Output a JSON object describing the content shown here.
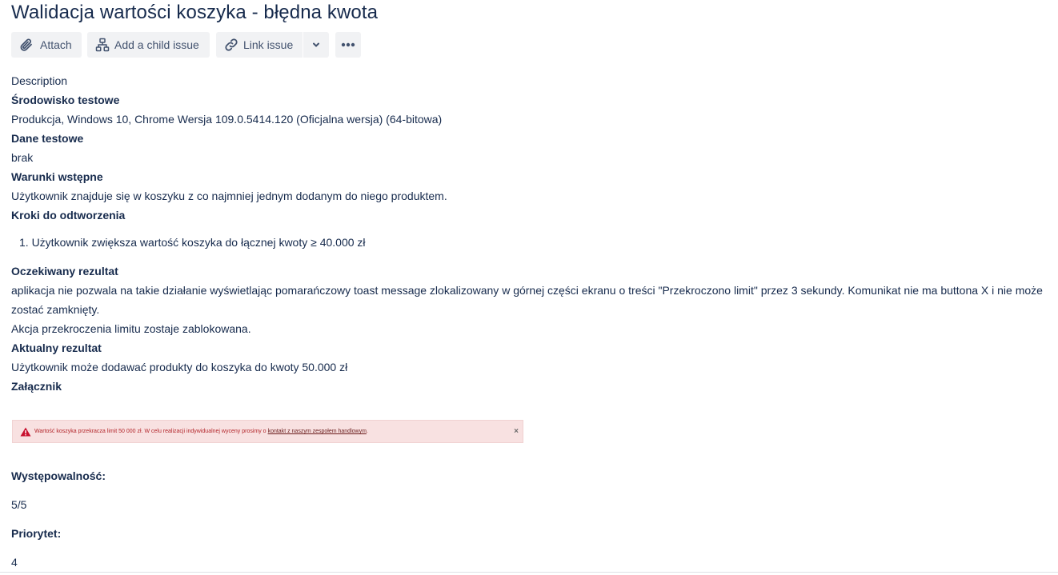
{
  "issue": {
    "title": "Walidacja wartości koszyka - błędna kwota"
  },
  "toolbar": {
    "attach_label": "Attach",
    "child_label": "Add a child issue",
    "link_label": "Link issue",
    "icons": [
      "attach-icon",
      "child-issue-icon",
      "link-icon",
      "chevron-down-icon",
      "more-icon"
    ]
  },
  "description": {
    "label": "Description",
    "env_heading": "Środowisko testowe",
    "env_text": "Produkcja, Windows 10, Chrome Wersja 109.0.5414.120 (Oficjalna wersja) (64-bitowa)",
    "data_heading": "Dane testowe",
    "data_text": "brak",
    "pre_heading": "Warunki wstępne",
    "pre_text": "Użytkownik znajduje się w koszyku z co najmniej jednym dodanym do niego produktem.",
    "steps_heading": "Kroki do odtworzenia",
    "steps": [
      "1. Użytkownik zwiększa wartość koszyka do łącznej kwoty ≥ 40.000 zł"
    ],
    "expected_heading": "Oczekiwany rezultat",
    "expected_text": "aplikacja nie pozwala na takie działanie wyświetlając pomarańczowy toast message zlokalizowany w górnej części ekranu o treści \"Przekroczono limit\" przez 3 sekundy. Komunikat nie ma buttona X i nie może zostać zamknięty.",
    "expected_text2": "Akcja przekroczenia limitu zostaje zablokowana.",
    "actual_heading": "Aktualny rezultat",
    "actual_text": "Użytkownik może dodawać produkty do koszyka do kwoty 50.000 zł",
    "attachment_heading": "Załącznik"
  },
  "attachment": {
    "message": "Wartość koszyka przekracza limit 50 000 zł. W celu realizacji indywidualnej wyceny prosimy o",
    "link": "kontakt z naszym zespołem handlowym",
    "period": ".",
    "close": "×",
    "bg_color": "#f8e1e1",
    "text_color": "#b3262b"
  },
  "fields": {
    "occurrence_label": "Występowalność:",
    "occurrence_value": "5/5",
    "priority_label": "Priorytet:",
    "priority_value": "4"
  }
}
